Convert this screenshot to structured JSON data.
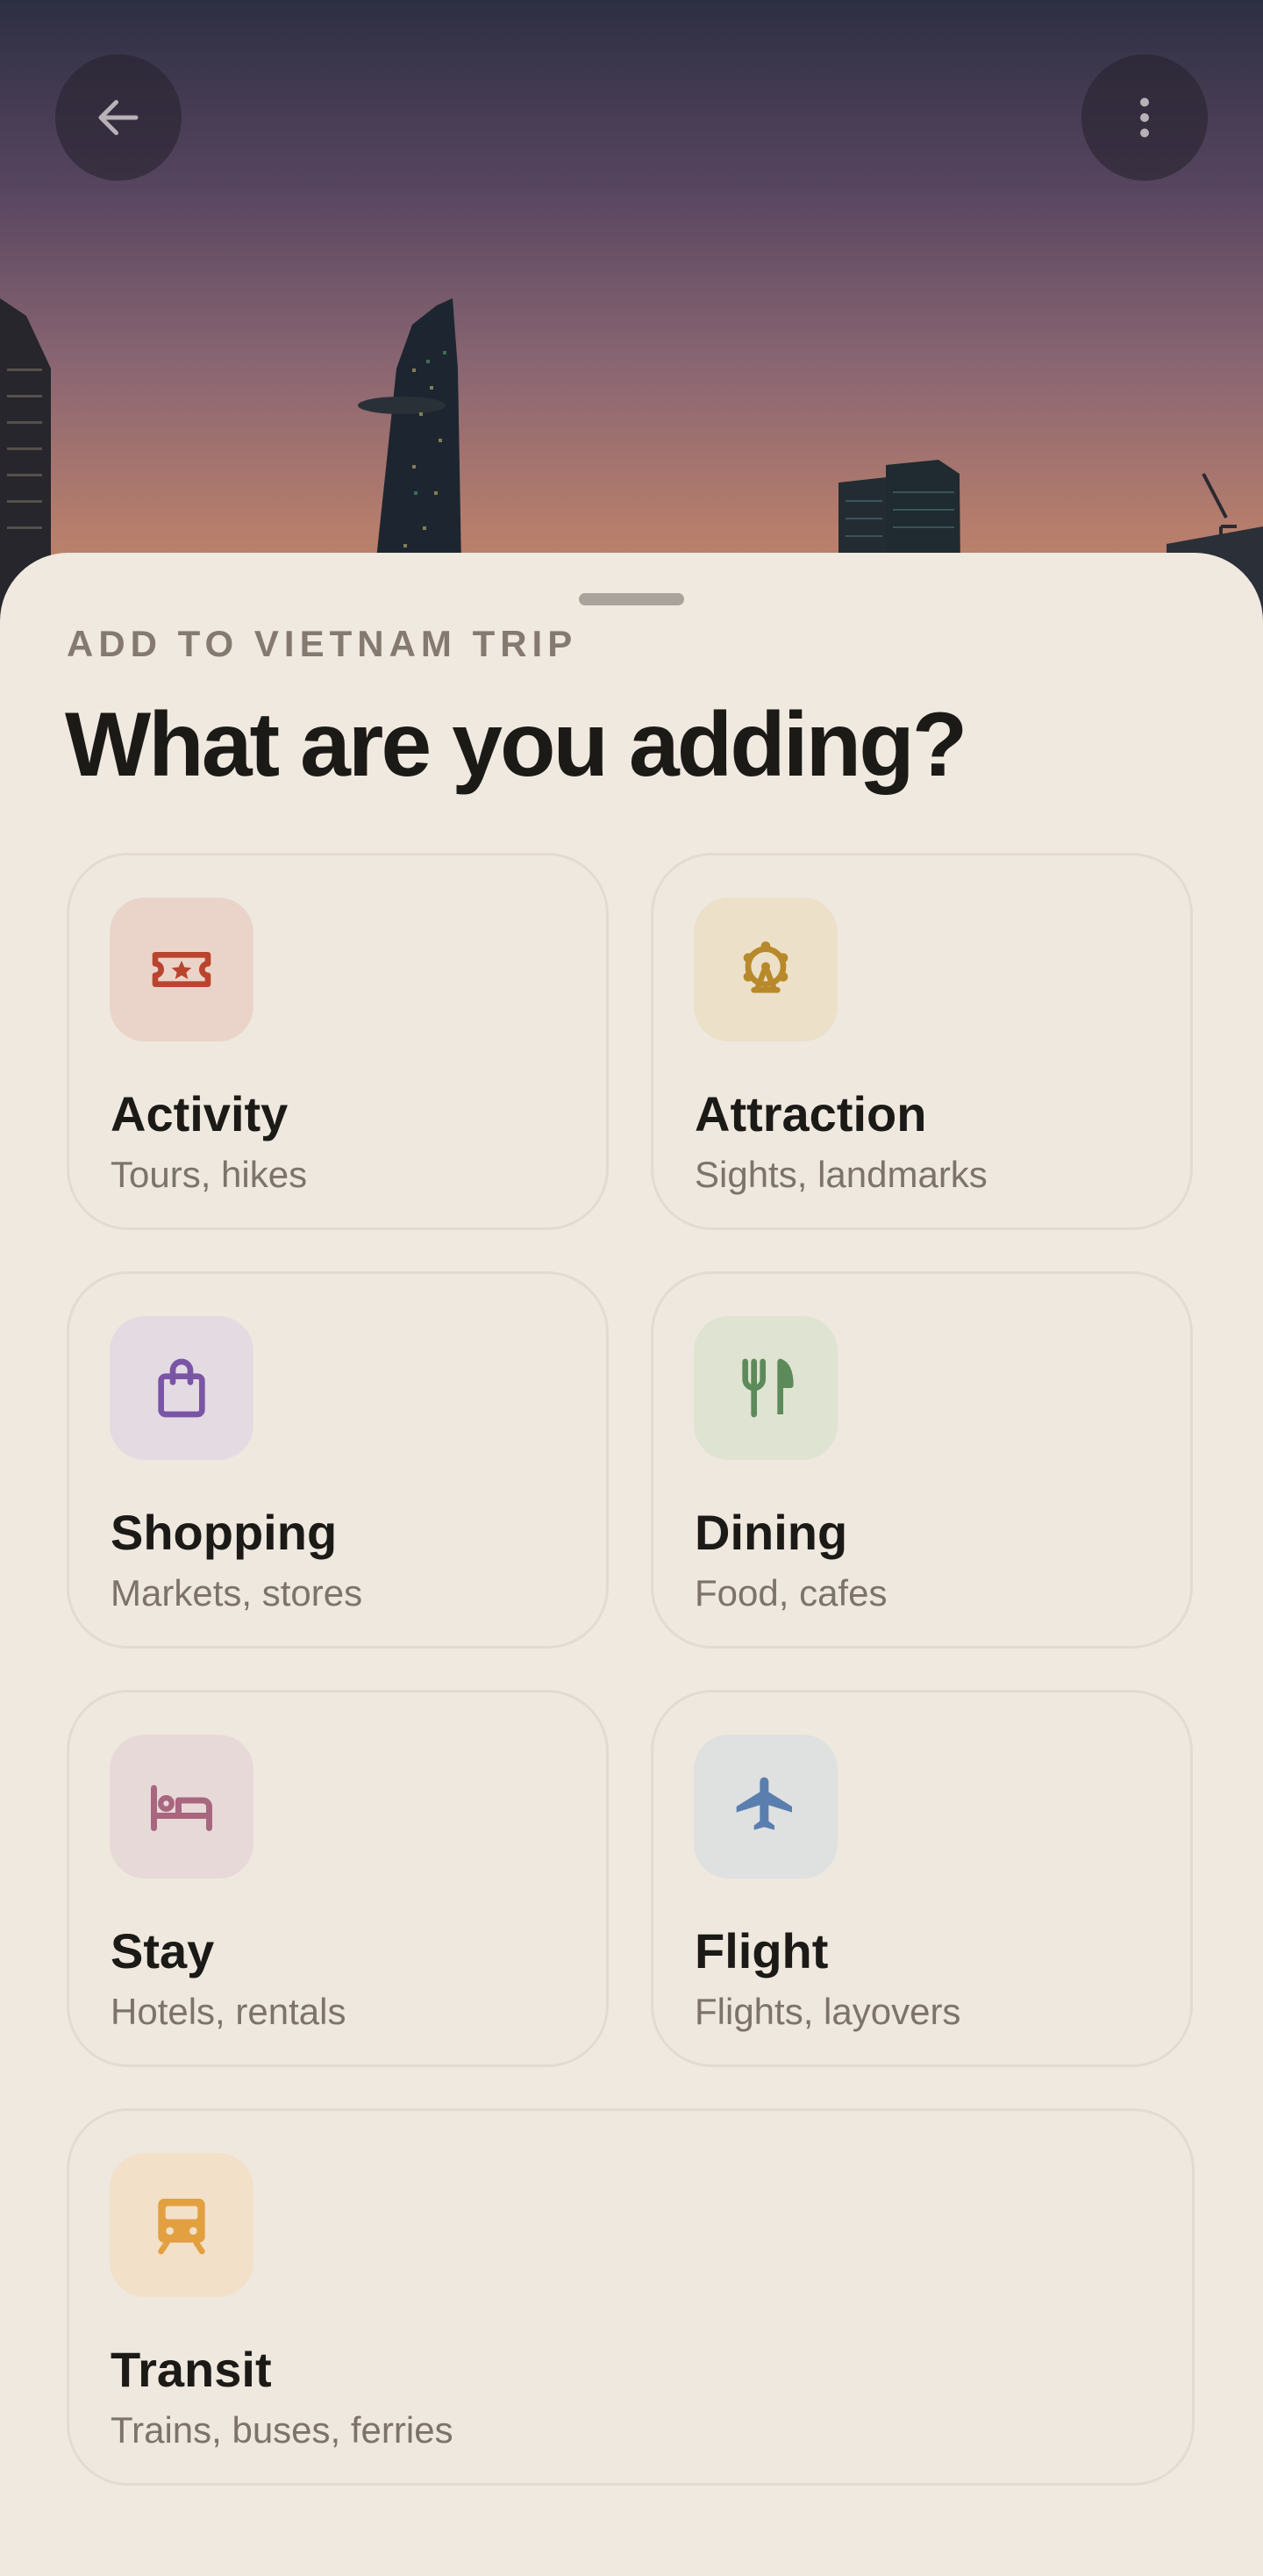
{
  "header": {
    "back_icon": "arrow-left-icon",
    "more_icon": "more-vertical-icon"
  },
  "sheet": {
    "eyebrow": "ADD TO VIETNAM TRIP",
    "title": "What are you adding?"
  },
  "categories": [
    {
      "label": "Activity",
      "subtitle": "Tours, hikes",
      "icon": "ticket-star-icon",
      "color": "#b9452f",
      "bg": "#ead4ca"
    },
    {
      "label": "Attraction",
      "subtitle": "Sights, landmarks",
      "icon": "ferris-wheel-icon",
      "color": "#b8892a",
      "bg": "#ece0c9"
    },
    {
      "label": "Shopping",
      "subtitle": "Markets, stores",
      "icon": "shopping-bag-icon",
      "color": "#7a55a6",
      "bg": "#e4dbe2"
    },
    {
      "label": "Dining",
      "subtitle": "Food, cafes",
      "icon": "fork-knife-icon",
      "color": "#5d8a5a",
      "bg": "#dfe3d2"
    },
    {
      "label": "Stay",
      "subtitle": "Hotels, rentals",
      "icon": "bed-icon",
      "color": "#a8677f",
      "bg": "#e8d9d9"
    },
    {
      "label": "Flight",
      "subtitle": "Flights, layovers",
      "icon": "airplane-icon",
      "color": "#5a7fae",
      "bg": "#dfe0e0"
    },
    {
      "label": "Transit",
      "subtitle": "Trains, buses, ferries",
      "icon": "train-icon",
      "color": "#e3a040",
      "bg": "#f2e0c8"
    }
  ]
}
